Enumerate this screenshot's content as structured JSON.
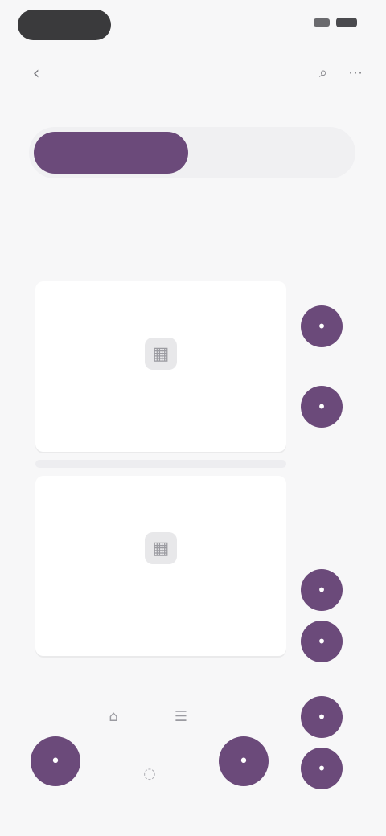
{
  "status": {
    "icons": [
      "cellular-icon",
      "battery-icon"
    ]
  },
  "topbar": {
    "back_icon": "chevron-left-icon",
    "actions": [
      "search-icon",
      "more-icon"
    ]
  },
  "segmented": {
    "left_label": "",
    "right_label": ""
  },
  "header": {
    "title": "",
    "subtitle": ""
  },
  "cards": [
    {
      "label": "",
      "icon": "placeholder-icon"
    },
    {
      "label": "",
      "icon": "placeholder-icon"
    }
  ],
  "right_rail": {
    "buttons": [
      "round-button",
      "round-button",
      "round-button",
      "round-button",
      "round-button",
      "round-button"
    ]
  },
  "bottom": {
    "left_button_icon": "round-button",
    "mid_button_icon": "round-button"
  },
  "colors": {
    "accent": "#6b4a7a",
    "background": "#f7f7f8",
    "card": "#ffffff",
    "text": "#2f2f32"
  }
}
